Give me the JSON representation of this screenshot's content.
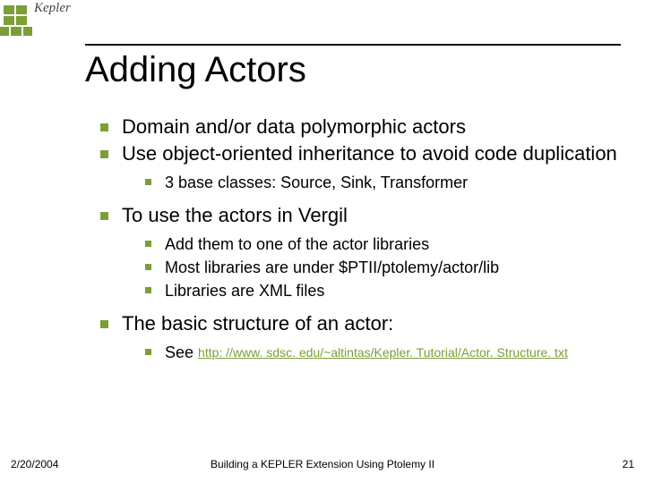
{
  "logo": {
    "text": "Kepler"
  },
  "title": "Adding Actors",
  "bullets": {
    "b1": "Domain and/or data polymorphic actors",
    "b2": "Use object-oriented inheritance to avoid code duplication",
    "b2_sub1": "3 base classes: Source, Sink, Transformer",
    "b3": "To use the actors in Vergil",
    "b3_sub1": "Add them to one of the actor libraries",
    "b3_sub2": "Most libraries are under $PTII/ptolemy/actor/lib",
    "b3_sub3": "Libraries are XML files",
    "b4": "The basic structure of an actor:",
    "b4_sub1_prefix": "See ",
    "b4_sub1_link": "http: //www. sdsc. edu/~altintas/Kepler. Tutorial/Actor. Structure. txt"
  },
  "footer": {
    "date": "2/20/2004",
    "title": "Building a KEPLER Extension Using Ptolemy II",
    "slide_number": "21"
  }
}
